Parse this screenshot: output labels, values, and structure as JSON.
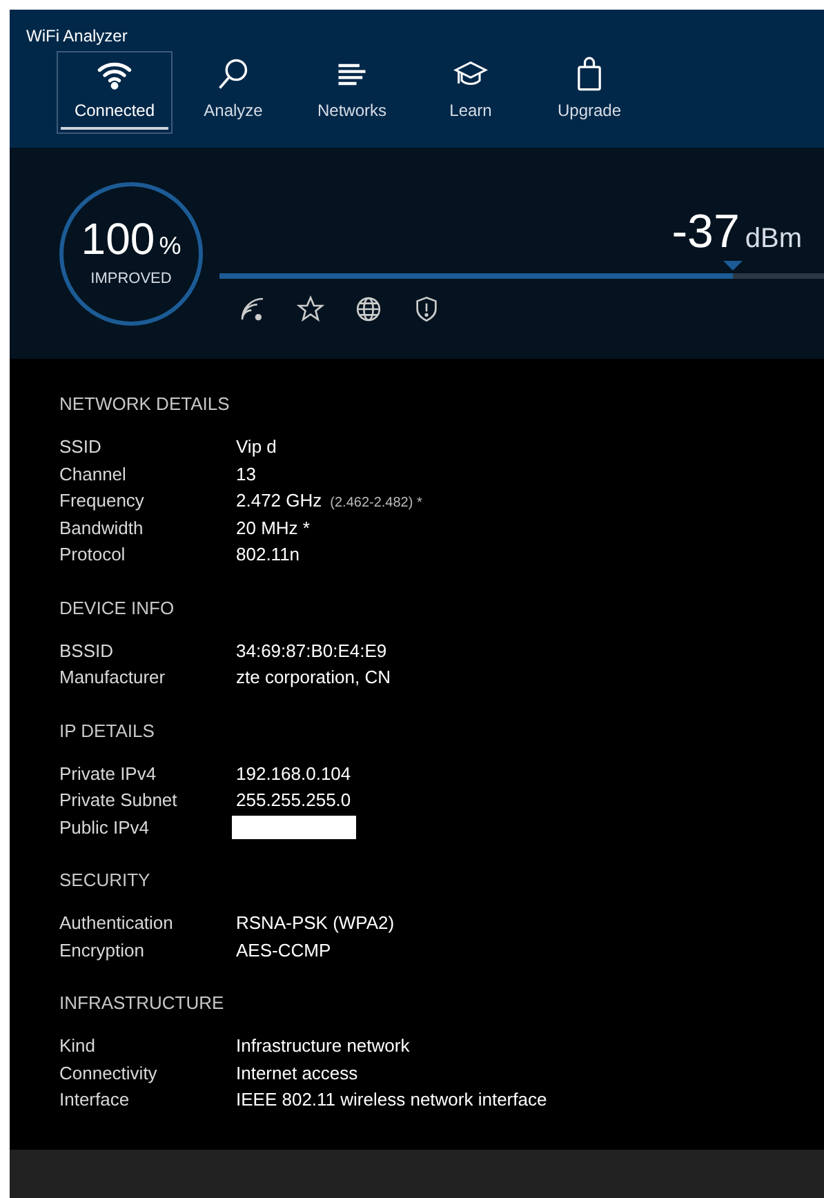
{
  "window": {
    "title": "WiFi Analyzer"
  },
  "tabs": [
    {
      "label": "Connected",
      "selected": true
    },
    {
      "label": "Analyze",
      "selected": false
    },
    {
      "label": "Networks",
      "selected": false
    },
    {
      "label": "Learn",
      "selected": false
    },
    {
      "label": "Upgrade",
      "selected": false
    }
  ],
  "score": {
    "value": "100",
    "unit": "%",
    "caption": "IMPROVED"
  },
  "signal": {
    "value": "-37",
    "unit": "dBm",
    "level": 0.85
  },
  "sections": [
    {
      "title": "NETWORK DETAILS",
      "rows": [
        {
          "label": "SSID",
          "value": "Vip d"
        },
        {
          "label": "Channel",
          "value": "13"
        },
        {
          "label": "Frequency",
          "value": "2.472 GHz",
          "note": "(2.462-2.482) *"
        },
        {
          "label": "Bandwidth",
          "value": "20 MHz *"
        },
        {
          "label": "Protocol",
          "value": "802.11n"
        }
      ]
    },
    {
      "title": "DEVICE INFO",
      "rows": [
        {
          "label": "BSSID",
          "value": "34:69:87:B0:E4:E9"
        },
        {
          "label": "Manufacturer",
          "value": "zte corporation, CN"
        }
      ]
    },
    {
      "title": "IP DETAILS",
      "rows": [
        {
          "label": "Private IPv4",
          "value": "192.168.0.104"
        },
        {
          "label": "Private Subnet",
          "value": "255.255.255.0"
        },
        {
          "label": "Public IPv4",
          "redacted": true
        }
      ]
    },
    {
      "title": "SECURITY",
      "rows": [
        {
          "label": "Authentication",
          "value": "RSNA-PSK (WPA2)"
        },
        {
          "label": "Encryption",
          "value": "AES-CCMP"
        }
      ]
    },
    {
      "title": "INFRASTRUCTURE",
      "rows": [
        {
          "label": "Kind",
          "value": "Infrastructure network"
        },
        {
          "label": "Connectivity",
          "value": "Internet access"
        },
        {
          "label": "Interface",
          "value": "IEEE 802.11 wireless network interface"
        }
      ]
    }
  ]
}
